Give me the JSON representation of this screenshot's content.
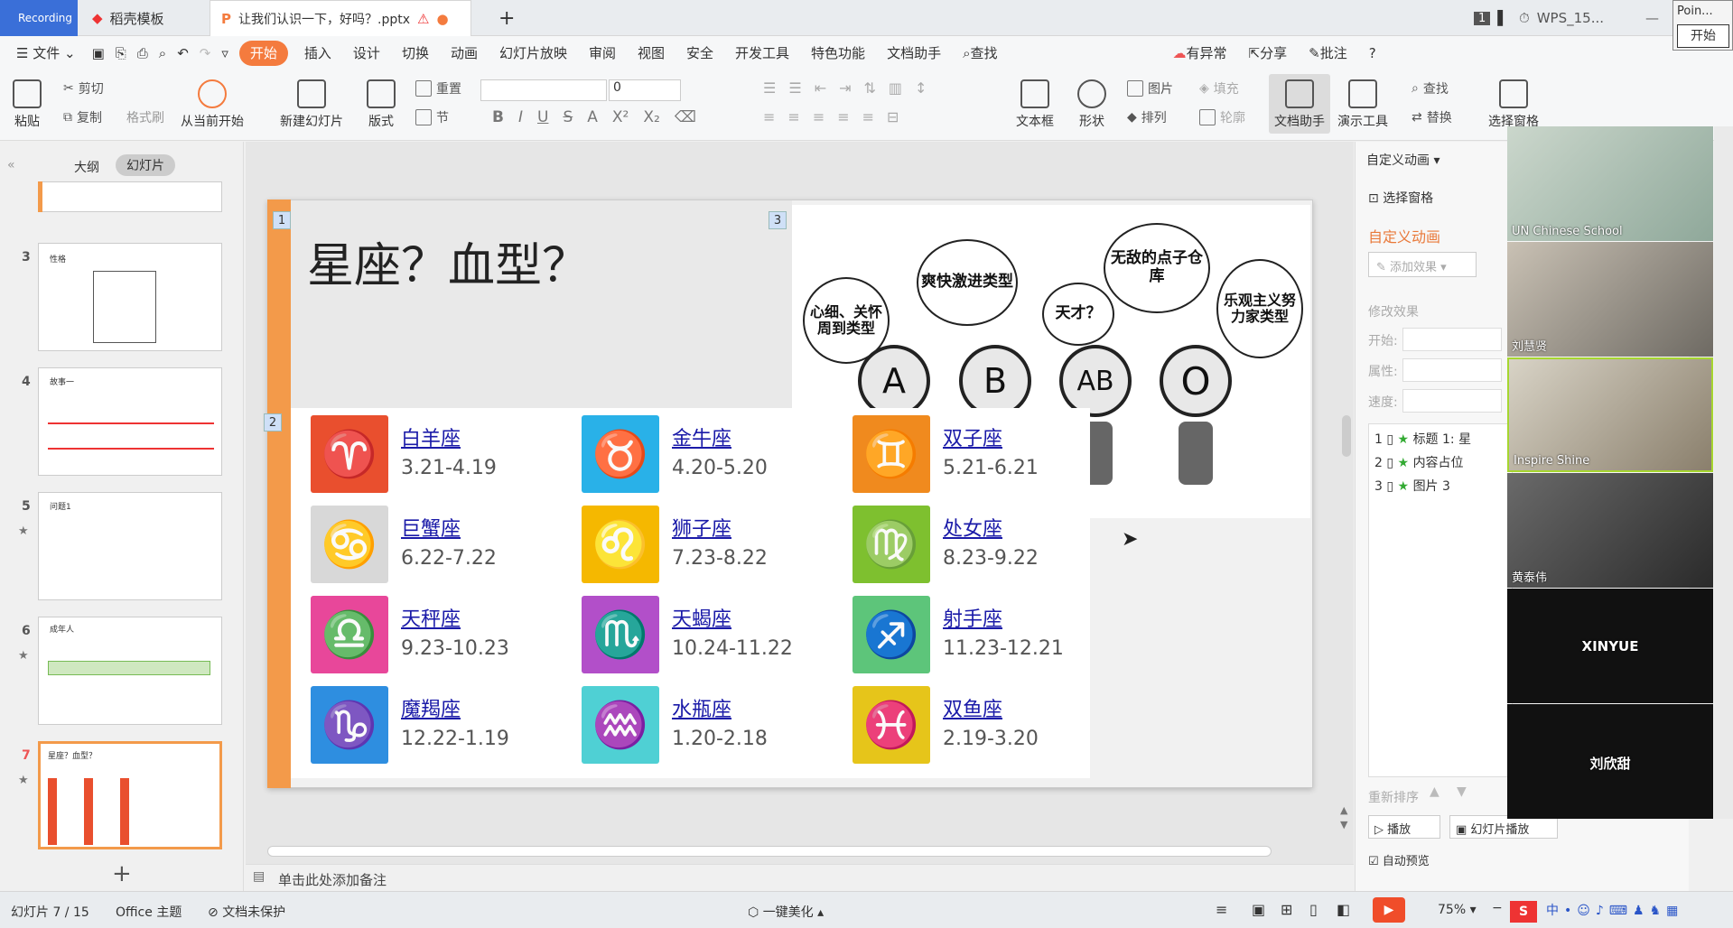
{
  "tabs": {
    "recording": "Recording",
    "template": "稻壳模板",
    "document": "让我们认识一下，好吗？.pptx",
    "new_tab": "+",
    "badge": "1",
    "wps_title": "WPS_15..."
  },
  "menus": [
    "文件",
    "开始",
    "插入",
    "设计",
    "切换",
    "动画",
    "幻灯片放映",
    "审阅",
    "视图",
    "安全",
    "开发工具",
    "特色功能",
    "文档助手",
    "查找"
  ],
  "menu_right": {
    "warning": "有异常",
    "share": "分享",
    "annotate": "批注",
    "help": "?"
  },
  "ribbon": {
    "paste": "粘贴",
    "cut": "剪切",
    "copy": "复制",
    "format_painter": "格式刷",
    "from_current": "从当前开始",
    "new_slide": "新建幻灯片",
    "layout": "版式",
    "reset": "重置",
    "section": "节",
    "font_size": "0",
    "textbox": "文本框",
    "shape": "形状",
    "picture": "图片",
    "fill": "填充",
    "arrange": "排列",
    "outline": "轮廓",
    "doc_assistant": "文档助手",
    "present_tool": "演示工具",
    "find": "查找",
    "replace": "替换",
    "select_pane": "选择窗格"
  },
  "left_panel": {
    "tab_outline": "大纲",
    "tab_slides": "幻灯片",
    "slides": [
      {
        "num": "3",
        "title": "性格"
      },
      {
        "num": "4",
        "title": "故事一"
      },
      {
        "num": "5",
        "title": "问题1"
      },
      {
        "num": "6",
        "title": "成年人"
      },
      {
        "num": "7",
        "title": "星座？血型？"
      }
    ],
    "add": "+"
  },
  "slide": {
    "title": "星座？血型？",
    "markers": [
      "1",
      "2",
      "3"
    ],
    "blood_types": [
      {
        "coin": "A",
        "bubble": "心细、关怀周到类型"
      },
      {
        "coin": "B",
        "bubble": "爽快激进类型"
      },
      {
        "coin": "AB",
        "bubble": "天才？"
      },
      {
        "coin": "AB",
        "bubble": "无敌的点子仓库"
      },
      {
        "coin": "O",
        "bubble": "乐观主义努力家类型"
      }
    ],
    "zodiac": [
      {
        "symbol": "♈",
        "name": "白羊座",
        "date": "3.21-4.19",
        "color": "#e94f2e"
      },
      {
        "symbol": "♉",
        "name": "金牛座",
        "date": "4.20-5.20",
        "color": "#29b1e8"
      },
      {
        "symbol": "♊",
        "name": "双子座",
        "date": "5.21-6.21",
        "color": "#f08a1e"
      },
      {
        "symbol": "♋",
        "name": "巨蟹座",
        "date": "6.22-7.22",
        "color": "#d8d8d8"
      },
      {
        "symbol": "♌",
        "name": "狮子座",
        "date": "7.23-8.22",
        "color": "#f5b800"
      },
      {
        "symbol": "♍",
        "name": "处女座",
        "date": "8.23-9.22",
        "color": "#7ec02f"
      },
      {
        "symbol": "♎",
        "name": "天秤座",
        "date": "9.23-10.23",
        "color": "#e8479a"
      },
      {
        "symbol": "♏",
        "name": "天蝎座",
        "date": "10.24-11.22",
        "color": "#b24fc9"
      },
      {
        "symbol": "♐",
        "name": "射手座",
        "date": "11.23-12.21",
        "color": "#5dc57a"
      },
      {
        "symbol": "♑",
        "name": "魔羯座",
        "date": "12.22-1.19",
        "color": "#2e8ee0"
      },
      {
        "symbol": "♒",
        "name": "水瓶座",
        "date": "1.20-2.18",
        "color": "#4fd0d4"
      },
      {
        "symbol": "♓",
        "name": "双鱼座",
        "date": "2.19-3.20",
        "color": "#e6c51a"
      }
    ]
  },
  "notes_placeholder": "单击此处添加备注",
  "right_panel": {
    "header": "自定义动画",
    "select_pane": "选择窗格",
    "section_title": "自定义动画",
    "add_effect": "添加效果",
    "modify": "修改效果",
    "start": "开始:",
    "property": "属性:",
    "speed": "速度:",
    "items": [
      {
        "num": "1",
        "label": "标题 1: 星"
      },
      {
        "num": "2",
        "label": "内容占位"
      },
      {
        "num": "3",
        "label": "图片 3"
      }
    ],
    "reorder": "重新排序",
    "play": "播放",
    "slideshow": "幻灯片播放",
    "autopreview": "自动预览"
  },
  "video": {
    "header": "Poin...",
    "start": "开始",
    "participants": [
      {
        "name": "UN Chinese School",
        "cam": true
      },
      {
        "name": "刘慧贤",
        "cam": true
      },
      {
        "name": "Inspire Shine",
        "cam": true
      },
      {
        "name": "黄泰伟",
        "cam": true
      },
      {
        "name": "XINYUE",
        "cam": false
      },
      {
        "name": "刘欣甜",
        "cam": false
      }
    ]
  },
  "status": {
    "slide_pos": "幻灯片 7 / 15",
    "theme": "Office 主题",
    "protect": "文档未保护",
    "beautify": "一键美化",
    "zoom": "75%"
  }
}
